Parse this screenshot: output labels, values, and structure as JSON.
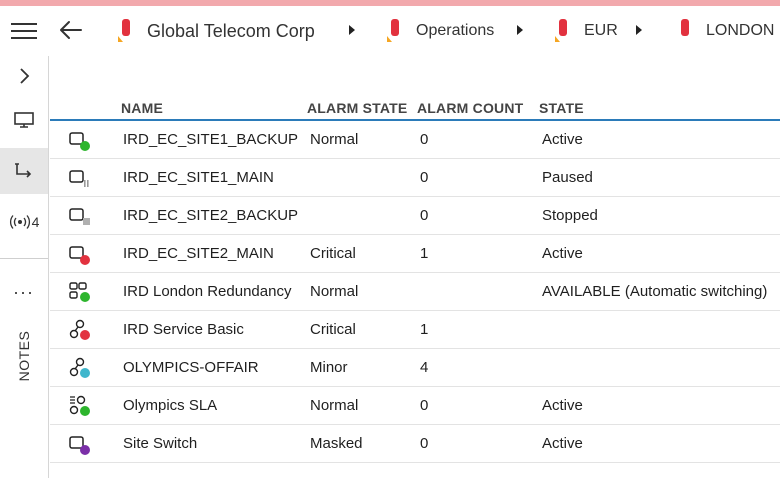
{
  "breadcrumb": [
    {
      "label": "Global Telecom Corp"
    },
    {
      "label": "Operations"
    },
    {
      "label": "EUR"
    },
    {
      "label": "LONDON"
    }
  ],
  "sidebar": {
    "counter": "4",
    "ellipsis": "...",
    "notes_label": "NOTES"
  },
  "table": {
    "columns": [
      "NAME",
      "ALARM STATE",
      "ALARM COUNT",
      "STATE"
    ],
    "rows": [
      {
        "name": "IRD_EC_SITE1_BACKUP",
        "alarm_state": "Normal",
        "alarm_count": "0",
        "state": "Active",
        "icon": "service-element-icon",
        "status_color": "#2db52d"
      },
      {
        "name": "IRD_EC_SITE1_MAIN",
        "alarm_state": "",
        "alarm_count": "0",
        "state": "Paused",
        "icon": "service-element-paused-icon",
        "status_color": "#9a9a9a"
      },
      {
        "name": "IRD_EC_SITE2_BACKUP",
        "alarm_state": "",
        "alarm_count": "0",
        "state": "Stopped",
        "icon": "service-element-stopped-icon",
        "status_color": "#b0b0b0"
      },
      {
        "name": "IRD_EC_SITE2_MAIN",
        "alarm_state": "Critical",
        "alarm_count": "1",
        "state": "Active",
        "icon": "service-element-icon",
        "status_color": "#e2323f"
      },
      {
        "name": "IRD London Redundancy",
        "alarm_state": "Normal",
        "alarm_count": "",
        "state": "AVAILABLE (Automatic switching)",
        "icon": "redundancy-group-icon",
        "status_color": "#2db52d"
      },
      {
        "name": "IRD Service Basic",
        "alarm_state": "Critical",
        "alarm_count": "1",
        "state": "",
        "icon": "service-icon",
        "status_color": "#e2323f"
      },
      {
        "name": "OLYMPICS-OFFAIR",
        "alarm_state": "Minor",
        "alarm_count": "4",
        "state": "",
        "icon": "service-icon",
        "status_color": "#3fb6cc"
      },
      {
        "name": "Olympics SLA",
        "alarm_state": "Normal",
        "alarm_count": "0",
        "state": "Active",
        "icon": "sla-icon",
        "status_color": "#2db52d"
      },
      {
        "name": "Site Switch",
        "alarm_state": "Masked",
        "alarm_count": "0",
        "state": "Active",
        "icon": "service-element-icon",
        "status_color": "#7b2fa8"
      }
    ]
  },
  "colors": {
    "top_strip": "#f2a9ad",
    "header_rule": "#2b7bb9",
    "breadcrumb_icon": "#e2323f",
    "breadcrumb_icon_accent": "#f5a623"
  }
}
